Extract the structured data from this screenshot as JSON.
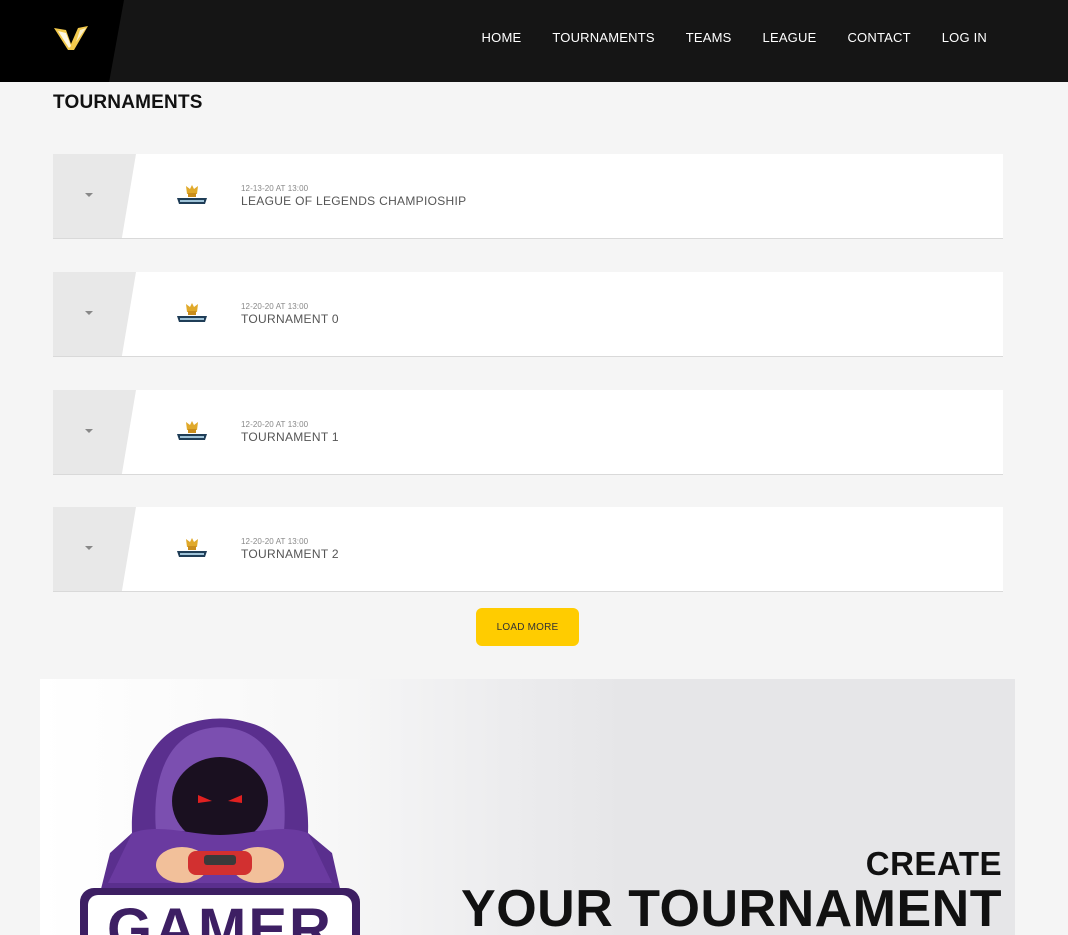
{
  "nav": {
    "items": [
      {
        "label": "HOME"
      },
      {
        "label": "TOURNAMENTS"
      },
      {
        "label": "TEAMS"
      },
      {
        "label": "LEAGUE"
      },
      {
        "label": "CONTACT"
      },
      {
        "label": "LOG IN"
      }
    ]
  },
  "page": {
    "title": "TOURNAMENTS"
  },
  "tournaments": [
    {
      "date": "12-13-20 AT 13:00",
      "name": "LEAGUE OF LEGENDS CHAMPIOSHIP",
      "icon": "chevron-down-icon",
      "badge": "tournament-logo"
    },
    {
      "date": "12-20-20 AT 13:00",
      "name": "TOURNAMENT 0",
      "icon": "chevron-down-icon",
      "badge": "tournament-logo"
    },
    {
      "date": "12-20-20 AT 13:00",
      "name": "TOURNAMENT 1",
      "icon": "chevron-down-icon",
      "badge": "tournament-logo"
    },
    {
      "date": "12-20-20 AT 13:00",
      "name": "TOURNAMENT 2",
      "icon": "chevron-down-icon",
      "badge": "tournament-logo"
    }
  ],
  "load_more": {
    "label": "LOAD MORE"
  },
  "promo": {
    "subtitle": "CREATE",
    "title": "YOUR TOURNAMENT",
    "art_text": "GAMER"
  },
  "colors": {
    "header_bg": "#151515",
    "accent": "#ffcc00",
    "page_bg": "#f5f5f5",
    "gamer_purple": "#7b4fb0"
  }
}
